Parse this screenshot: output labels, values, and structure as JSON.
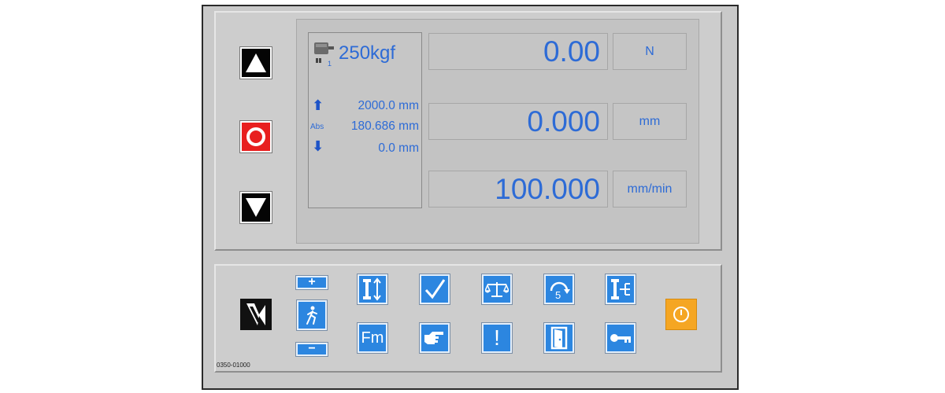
{
  "controller": {
    "load_cell_range": "250kgf",
    "load_cell_badge": "1",
    "limits": {
      "upper": "2000.0 mm",
      "abs_label": "Abs",
      "absolute": "180.686 mm",
      "lower": "0.0 mm"
    },
    "readouts": [
      {
        "value": "0.00",
        "unit": "N"
      },
      {
        "value": "0.000",
        "unit": "mm"
      },
      {
        "value": "100.000",
        "unit": "mm/min"
      }
    ],
    "panel_code": "0350-01000"
  },
  "buttons": {
    "plus_label": "+",
    "minus_label": "−",
    "fm_label": "Fm",
    "alert_label": "!",
    "cycle_count": "5"
  },
  "colors": {
    "accent_blue": "#2c86e0",
    "text_blue": "#2d6bd6",
    "stop_red": "#e81f1f",
    "power_orange": "#f5a623"
  }
}
